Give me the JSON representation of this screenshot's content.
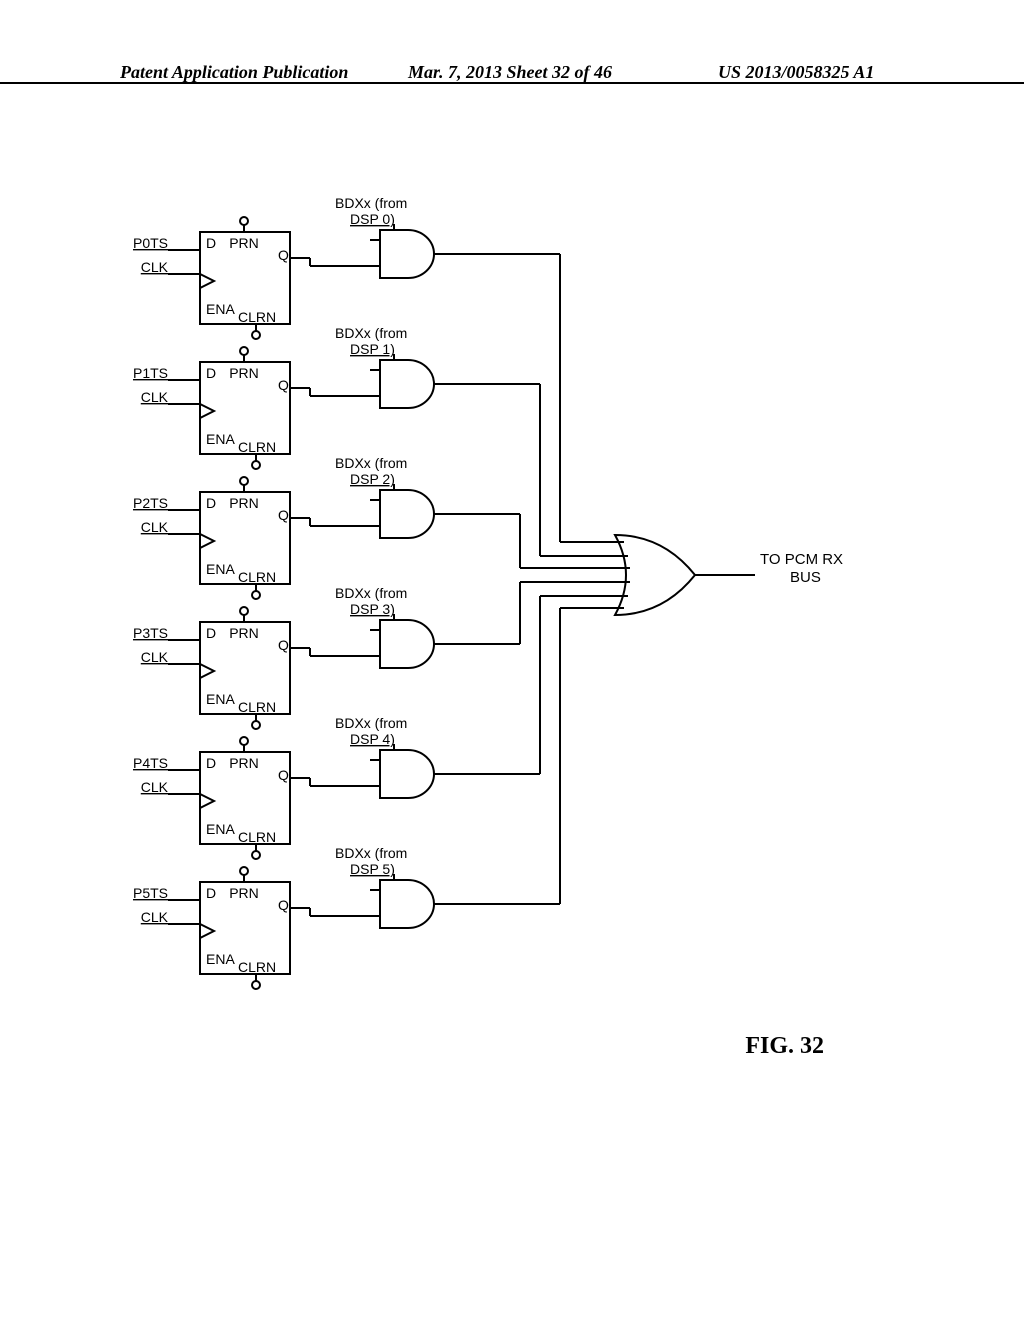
{
  "header": {
    "left": "Patent Application Publication",
    "mid": "Mar. 7, 2013  Sheet 32 of 46",
    "right": "US 2013/0058325 A1"
  },
  "flipflop_labels": {
    "D": "D",
    "PRN": "PRN",
    "Q": "Q",
    "ENA": "ENA",
    "CLRN": "CLRN"
  },
  "stages": [
    {
      "pts": "P0TS",
      "clk": "CLK",
      "bdxx1": "BDXx (from",
      "bdxx2": "DSP 0)"
    },
    {
      "pts": "P1TS",
      "clk": "CLK",
      "bdxx1": "BDXx (from",
      "bdxx2": "DSP 1)"
    },
    {
      "pts": "P2TS",
      "clk": "CLK",
      "bdxx1": "BDXx (from",
      "bdxx2": "DSP 2)"
    },
    {
      "pts": "P3TS",
      "clk": "CLK",
      "bdxx1": "BDXx (from",
      "bdxx2": "DSP 3)"
    },
    {
      "pts": "P4TS",
      "clk": "CLK",
      "bdxx1": "BDXx (from",
      "bdxx2": "DSP 4)"
    },
    {
      "pts": "P5TS",
      "clk": "CLK",
      "bdxx1": "BDXx (from",
      "bdxx2": "DSP 5)"
    }
  ],
  "output": {
    "line1": "TO PCM RX",
    "line2": "BUS"
  },
  "figure": "FIG. 32"
}
